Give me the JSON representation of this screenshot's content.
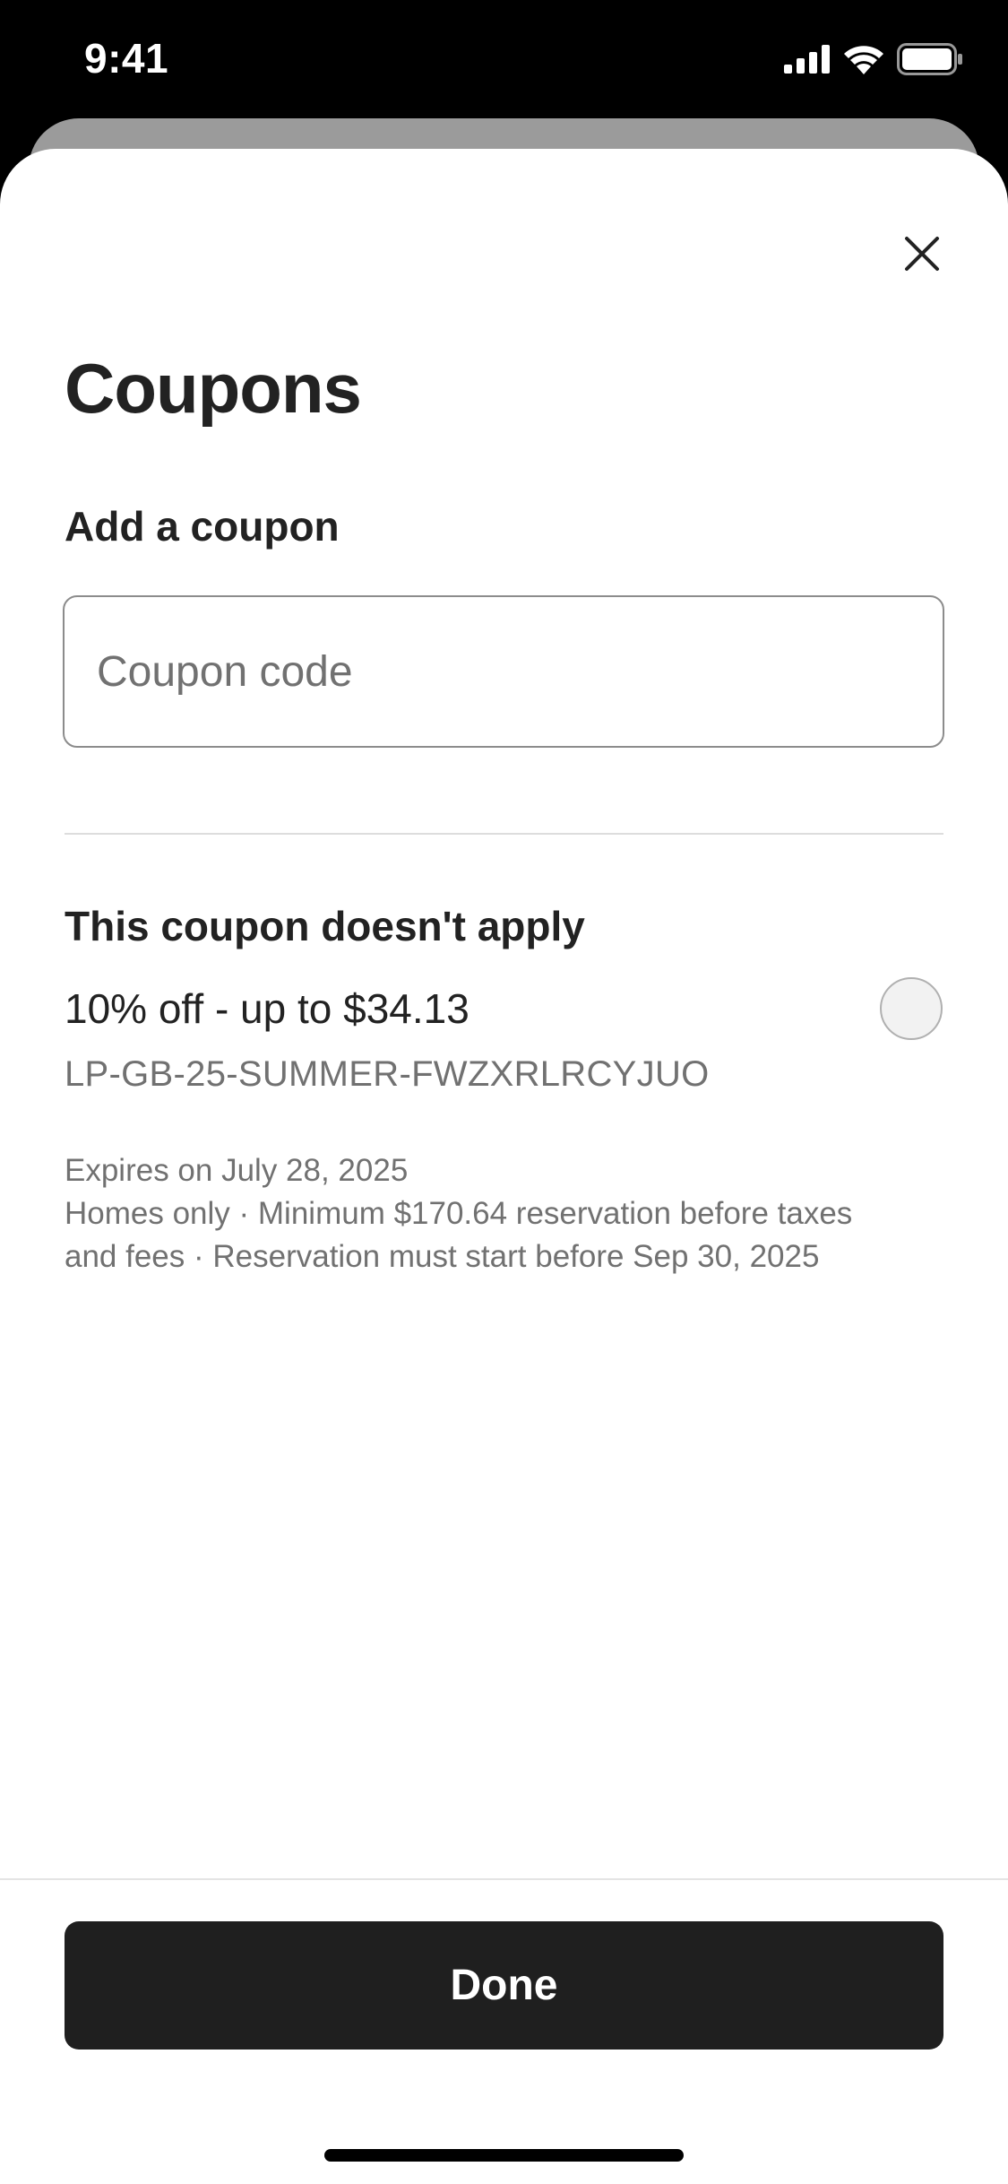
{
  "status_bar": {
    "time": "9:41",
    "icons": [
      "cellular-signal-icon",
      "wifi-icon",
      "battery-icon"
    ]
  },
  "sheet": {
    "close_icon": "close-icon",
    "title": "Coupons",
    "add_section": {
      "heading": "Add a coupon",
      "input_placeholder": "Coupon code",
      "input_value": ""
    },
    "coupon": {
      "status_heading": "This coupon doesn't apply",
      "offer": "10% off - up to $34.13",
      "code": "LP-GB-25-SUMMER-FWZXRLRCYJUO",
      "selected": false,
      "expires": "Expires on July 28, 2025",
      "terms": "Homes only · Minimum $170.64 reservation before taxes and fees · Reservation must start before Sep 30, 2025"
    },
    "done_label": "Done"
  },
  "colors": {
    "primary_text": "#222222",
    "secondary_text": "#717171",
    "button_bg": "#1f1f1f",
    "divider": "#dddddd"
  }
}
